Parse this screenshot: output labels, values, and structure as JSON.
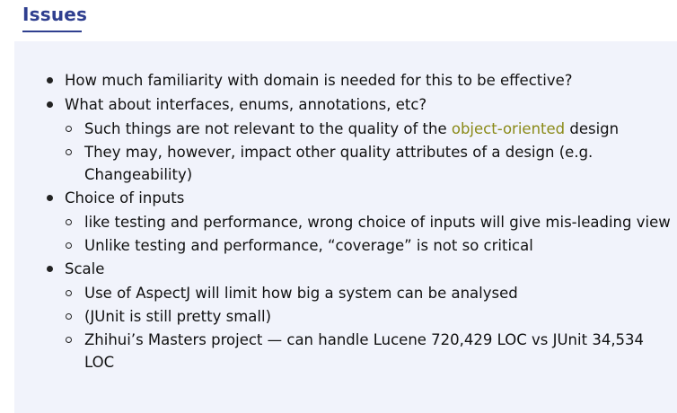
{
  "slide": {
    "title": "Issues",
    "items": [
      {
        "text": "How much familiarity with domain is needed for this to be effective?",
        "subitems": []
      },
      {
        "text": "What about interfaces, enums, annotations, etc?",
        "subitems": [
          {
            "pre": "Such things are not relevant to the quality of the ",
            "highlight": "object-oriented",
            "post": " design"
          },
          {
            "pre": "They may, however, impact other quality attributes of a design (e.g. Changeability)"
          }
        ]
      },
      {
        "text": "Choice of inputs",
        "subitems": [
          {
            "pre": "like testing and performance, wrong choice of inputs will give mis-leading view"
          },
          {
            "pre": "Unlike testing and performance, “coverage” is not so critical"
          }
        ]
      },
      {
        "text": "Scale",
        "subitems": [
          {
            "pre": "Use of AspectJ will limit how big a system can be analysed"
          },
          {
            "pre": "(JUnit is still pretty small)"
          },
          {
            "pre": "Zhihui’s Masters project — can handle Lucene 720,429 LOC vs JUnit 34,534 LOC"
          }
        ]
      }
    ],
    "colors": {
      "title": "#2f3f8f",
      "panel": "#f1f3fb",
      "highlight": "#8a8a18"
    }
  }
}
